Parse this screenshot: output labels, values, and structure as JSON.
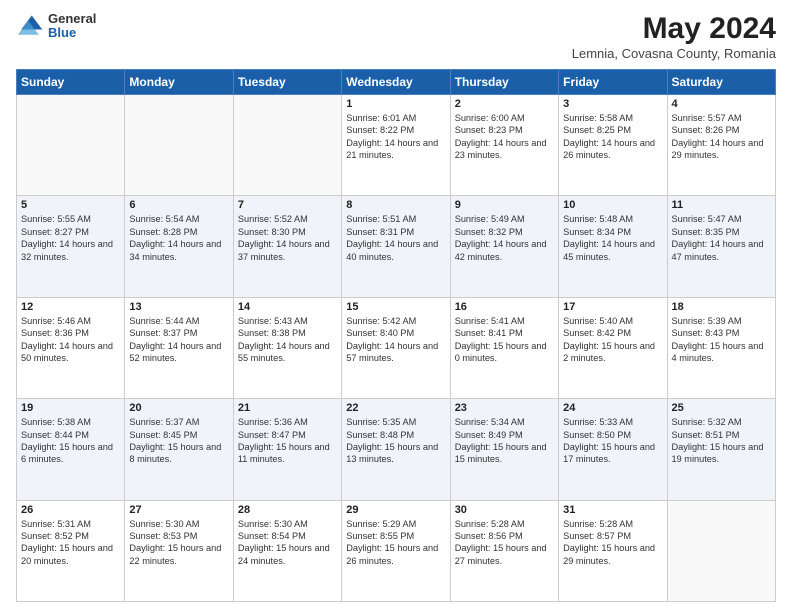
{
  "logo": {
    "general": "General",
    "blue": "Blue"
  },
  "header": {
    "month": "May 2024",
    "location": "Lemnia, Covasna County, Romania"
  },
  "days": [
    "Sunday",
    "Monday",
    "Tuesday",
    "Wednesday",
    "Thursday",
    "Friday",
    "Saturday"
  ],
  "weeks": [
    [
      {
        "day": "",
        "content": ""
      },
      {
        "day": "",
        "content": ""
      },
      {
        "day": "",
        "content": ""
      },
      {
        "day": "1",
        "content": "Sunrise: 6:01 AM\nSunset: 8:22 PM\nDaylight: 14 hours\nand 21 minutes."
      },
      {
        "day": "2",
        "content": "Sunrise: 6:00 AM\nSunset: 8:23 PM\nDaylight: 14 hours\nand 23 minutes."
      },
      {
        "day": "3",
        "content": "Sunrise: 5:58 AM\nSunset: 8:25 PM\nDaylight: 14 hours\nand 26 minutes."
      },
      {
        "day": "4",
        "content": "Sunrise: 5:57 AM\nSunset: 8:26 PM\nDaylight: 14 hours\nand 29 minutes."
      }
    ],
    [
      {
        "day": "5",
        "content": "Sunrise: 5:55 AM\nSunset: 8:27 PM\nDaylight: 14 hours\nand 32 minutes."
      },
      {
        "day": "6",
        "content": "Sunrise: 5:54 AM\nSunset: 8:28 PM\nDaylight: 14 hours\nand 34 minutes."
      },
      {
        "day": "7",
        "content": "Sunrise: 5:52 AM\nSunset: 8:30 PM\nDaylight: 14 hours\nand 37 minutes."
      },
      {
        "day": "8",
        "content": "Sunrise: 5:51 AM\nSunset: 8:31 PM\nDaylight: 14 hours\nand 40 minutes."
      },
      {
        "day": "9",
        "content": "Sunrise: 5:49 AM\nSunset: 8:32 PM\nDaylight: 14 hours\nand 42 minutes."
      },
      {
        "day": "10",
        "content": "Sunrise: 5:48 AM\nSunset: 8:34 PM\nDaylight: 14 hours\nand 45 minutes."
      },
      {
        "day": "11",
        "content": "Sunrise: 5:47 AM\nSunset: 8:35 PM\nDaylight: 14 hours\nand 47 minutes."
      }
    ],
    [
      {
        "day": "12",
        "content": "Sunrise: 5:46 AM\nSunset: 8:36 PM\nDaylight: 14 hours\nand 50 minutes."
      },
      {
        "day": "13",
        "content": "Sunrise: 5:44 AM\nSunset: 8:37 PM\nDaylight: 14 hours\nand 52 minutes."
      },
      {
        "day": "14",
        "content": "Sunrise: 5:43 AM\nSunset: 8:38 PM\nDaylight: 14 hours\nand 55 minutes."
      },
      {
        "day": "15",
        "content": "Sunrise: 5:42 AM\nSunset: 8:40 PM\nDaylight: 14 hours\nand 57 minutes."
      },
      {
        "day": "16",
        "content": "Sunrise: 5:41 AM\nSunset: 8:41 PM\nDaylight: 15 hours\nand 0 minutes."
      },
      {
        "day": "17",
        "content": "Sunrise: 5:40 AM\nSunset: 8:42 PM\nDaylight: 15 hours\nand 2 minutes."
      },
      {
        "day": "18",
        "content": "Sunrise: 5:39 AM\nSunset: 8:43 PM\nDaylight: 15 hours\nand 4 minutes."
      }
    ],
    [
      {
        "day": "19",
        "content": "Sunrise: 5:38 AM\nSunset: 8:44 PM\nDaylight: 15 hours\nand 6 minutes."
      },
      {
        "day": "20",
        "content": "Sunrise: 5:37 AM\nSunset: 8:45 PM\nDaylight: 15 hours\nand 8 minutes."
      },
      {
        "day": "21",
        "content": "Sunrise: 5:36 AM\nSunset: 8:47 PM\nDaylight: 15 hours\nand 11 minutes."
      },
      {
        "day": "22",
        "content": "Sunrise: 5:35 AM\nSunset: 8:48 PM\nDaylight: 15 hours\nand 13 minutes."
      },
      {
        "day": "23",
        "content": "Sunrise: 5:34 AM\nSunset: 8:49 PM\nDaylight: 15 hours\nand 15 minutes."
      },
      {
        "day": "24",
        "content": "Sunrise: 5:33 AM\nSunset: 8:50 PM\nDaylight: 15 hours\nand 17 minutes."
      },
      {
        "day": "25",
        "content": "Sunrise: 5:32 AM\nSunset: 8:51 PM\nDaylight: 15 hours\nand 19 minutes."
      }
    ],
    [
      {
        "day": "26",
        "content": "Sunrise: 5:31 AM\nSunset: 8:52 PM\nDaylight: 15 hours\nand 20 minutes."
      },
      {
        "day": "27",
        "content": "Sunrise: 5:30 AM\nSunset: 8:53 PM\nDaylight: 15 hours\nand 22 minutes."
      },
      {
        "day": "28",
        "content": "Sunrise: 5:30 AM\nSunset: 8:54 PM\nDaylight: 15 hours\nand 24 minutes."
      },
      {
        "day": "29",
        "content": "Sunrise: 5:29 AM\nSunset: 8:55 PM\nDaylight: 15 hours\nand 26 minutes."
      },
      {
        "day": "30",
        "content": "Sunrise: 5:28 AM\nSunset: 8:56 PM\nDaylight: 15 hours\nand 27 minutes."
      },
      {
        "day": "31",
        "content": "Sunrise: 5:28 AM\nSunset: 8:57 PM\nDaylight: 15 hours\nand 29 minutes."
      },
      {
        "day": "",
        "content": ""
      }
    ]
  ]
}
